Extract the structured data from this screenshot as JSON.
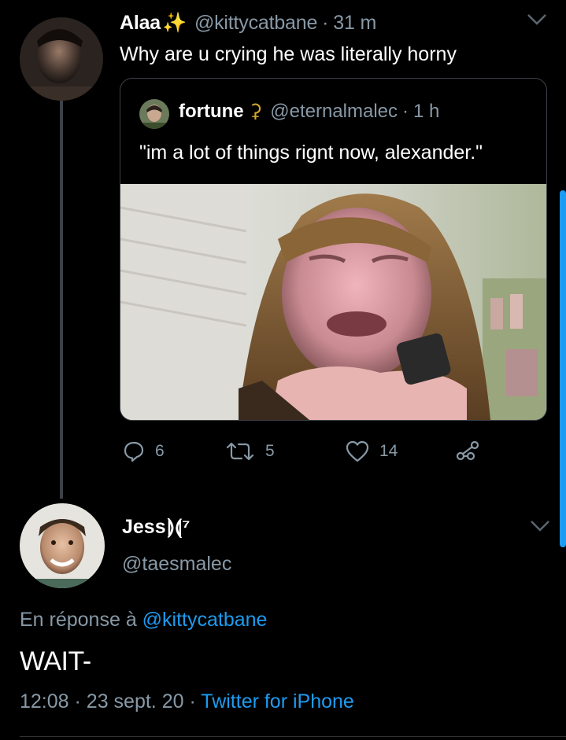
{
  "tweet1": {
    "display_name": "Alaa",
    "name_emoji": "✨",
    "handle": "@kittycatbane",
    "separator": "·",
    "time": "31 m",
    "text": "Why are u crying he was literally horny"
  },
  "quote": {
    "display_name": "fortune",
    "name_emoji": "⚳",
    "handle": "@eternalmalec",
    "separator": "·",
    "time": "1 h",
    "text": "\"im a lot of things rignt now, alexander.\""
  },
  "actions": {
    "reply_count": "6",
    "retweet_count": "5",
    "like_count": "14"
  },
  "tweet2": {
    "display_name": "Jess",
    "name_suffix": "⟭⟬⁷",
    "handle": "@taesmalec",
    "reply_prefix": "En réponse à",
    "reply_handle": "@kittycatbane",
    "text": "WAIT-",
    "time": "12:08",
    "date": "23 sept. 20",
    "separator": "·",
    "source": "Twitter for iPhone"
  },
  "colors": {
    "background": "#000000",
    "text_primary": "#ffffff",
    "text_muted": "#8899a6",
    "accent": "#1d9bf0",
    "border": "#3d4248"
  },
  "icons": [
    "chevron-down-icon",
    "reply-icon",
    "retweet-icon",
    "like-icon",
    "share-icon"
  ]
}
